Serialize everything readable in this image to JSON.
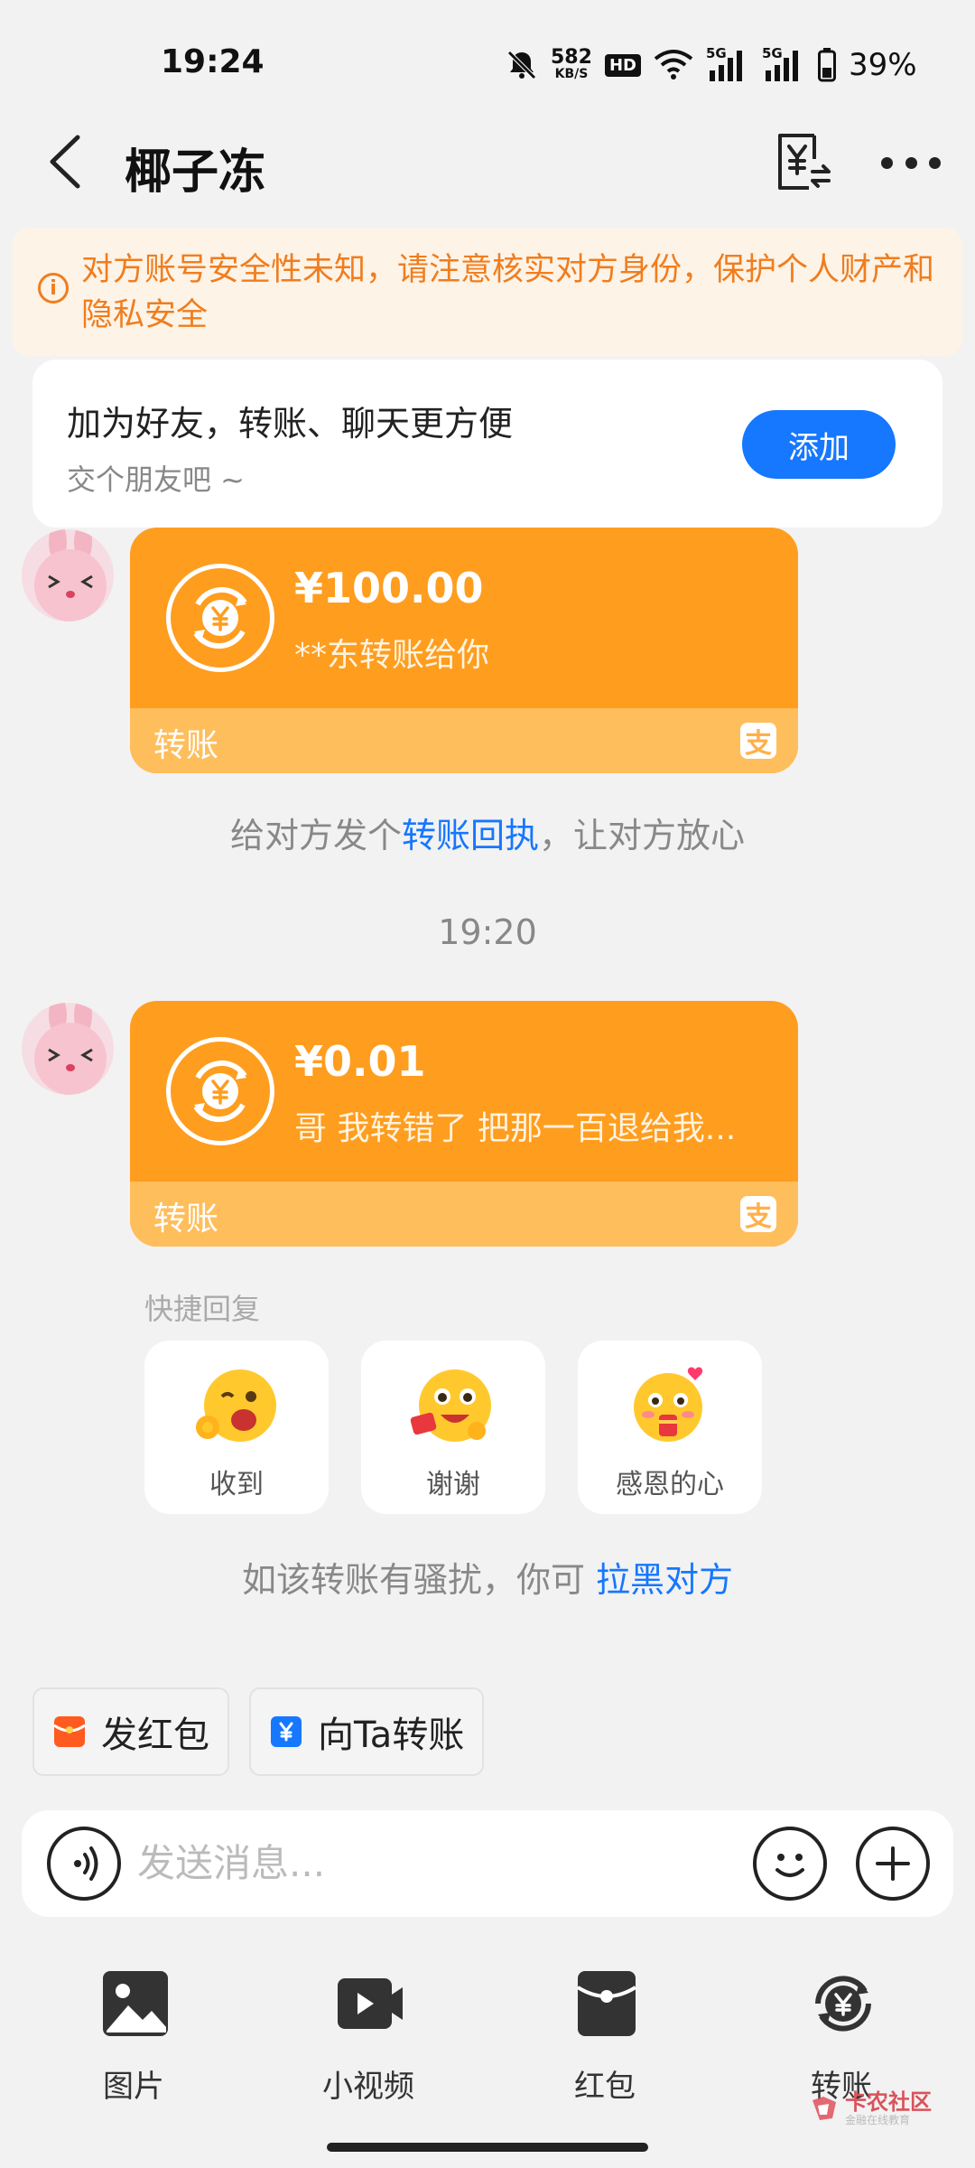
{
  "status_bar": {
    "time": "19:24",
    "net_speed_value": "582",
    "net_speed_unit": "KB/S",
    "hd_badge": "HD",
    "signal_1_label": "5G",
    "signal_2_label": "5G",
    "battery": "39%"
  },
  "header": {
    "title": "椰子冻"
  },
  "warning": {
    "text": "对方账号安全性未知，请注意核实对方身份，保护个人财产和隐私安全"
  },
  "friend_card": {
    "title": "加为好友，转账、聊天更方便",
    "subtitle": "交个朋友吧 ~",
    "add_label": "添加"
  },
  "messages": [
    {
      "amount": "¥100.00",
      "note": "**东转账给你",
      "label": "转账"
    },
    {
      "amount": "¥0.01",
      "note": "哥 我转错了 把那一百退给我...",
      "label": "转账"
    }
  ],
  "receipt_tip": {
    "before": "给对方发个",
    "link": "转账回执",
    "after": "，让对方放心"
  },
  "timestamp": "19:20",
  "quick_reply": {
    "title": "快捷回复",
    "items": [
      {
        "label": "收到",
        "icon": "ok-emoji-icon"
      },
      {
        "label": "谢谢",
        "icon": "thanks-emoji-icon"
      },
      {
        "label": "感恩的心",
        "icon": "grateful-emoji-icon"
      }
    ]
  },
  "block_tip": {
    "before": "如该转账有骚扰，你可 ",
    "link": "拉黑对方"
  },
  "chips": {
    "red_packet": "发红包",
    "transfer": "向Ta转账"
  },
  "input": {
    "placeholder": "发送消息..."
  },
  "tools": [
    {
      "label": "图片",
      "icon": "image-icon"
    },
    {
      "label": "小视频",
      "icon": "video-icon"
    },
    {
      "label": "红包",
      "icon": "red-packet-icon"
    },
    {
      "label": "转账",
      "icon": "transfer-icon"
    }
  ],
  "watermark": {
    "title": "卡农社区",
    "subtitle": "金融在线教育"
  },
  "colors": {
    "accent_blue": "#1677ff",
    "warning_orange": "#f07d1e",
    "transfer_orange": "#ff9d1e"
  }
}
